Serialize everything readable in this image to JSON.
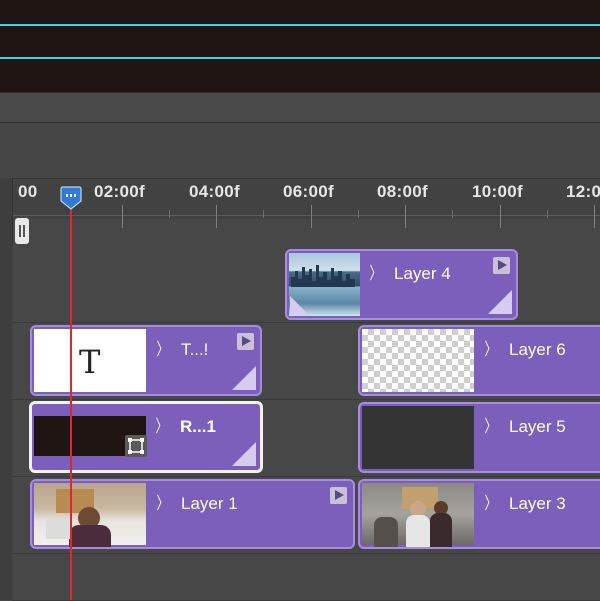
{
  "timeline": {
    "ruler_labels": [
      "00",
      "02:00f",
      "04:00f",
      "06:00f",
      "08:00f",
      "10:00f",
      "12:0"
    ],
    "clips": {
      "layer4": {
        "label": "Layer 4"
      },
      "text_clip": {
        "label": "T...!",
        "thumb_glyph": "T"
      },
      "layer6": {
        "label": "Layer 6"
      },
      "r_clip": {
        "label": "R...1"
      },
      "layer5": {
        "label": "Layer 5"
      },
      "layer1": {
        "label": "Layer 1"
      },
      "layer3": {
        "label": "Layer 3"
      }
    }
  },
  "colors": {
    "clip_purple": "#7c5fbb",
    "playhead_red": "#e2262c",
    "playhead_blue": "#2f7bd6",
    "guide_cyan": "#3fd4e4"
  },
  "icons": [
    "play-icon",
    "chevron-right-icon",
    "transform-icon",
    "work-area-handle-icon",
    "playhead-icon"
  ]
}
